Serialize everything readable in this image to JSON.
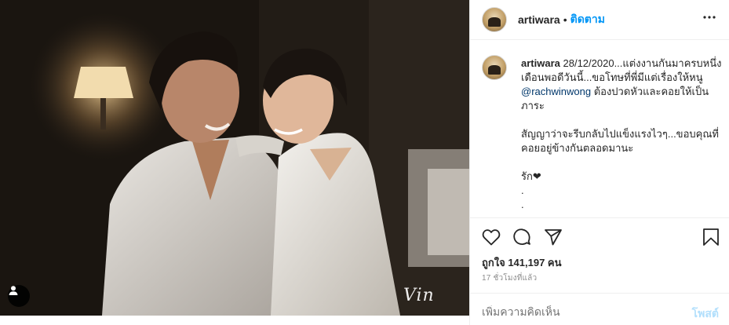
{
  "post": {
    "image_alt": "",
    "watermark": "Vin"
  },
  "header": {
    "username": "artiwara",
    "separator": "•",
    "follow_label": "ติดตาม",
    "more_icon": "more-horizontal-icon"
  },
  "caption": {
    "username": "artiwara",
    "line1": "28/12/2020...แต่งงานกันมาครบหนึ่งเดือนพอดีวันนี้...ขอโทษที่พี่มีแต่เรื่องให้หนู ",
    "mention": "@rachwinwong",
    "line1_end": " ต้องปวดหัวและคอยให้เป็นภาระ",
    "line2": "สัญญาว่าจะรีบกลับไปแข็งแรงไวๆ...ขอบคุณที่คอยอยู่ข้างกันตลอดมานะ",
    "line3": "รัก❤",
    "dot1": ".",
    "dot2": "."
  },
  "actions": {
    "like_icon": "heart-icon",
    "comment_icon": "comment-icon",
    "share_icon": "share-icon",
    "save_icon": "bookmark-icon"
  },
  "likes_text": "ถูกใจ 141,197 คน",
  "timestamp": "17 ชั่วโมงที่แล้ว",
  "comment_box": {
    "placeholder": "เพิ่มความคิดเห็น",
    "post_label": "โพสต์"
  },
  "colors": {
    "follow": "#0095f6",
    "post_disabled": "#b2dffc",
    "mention": "#00376b"
  }
}
